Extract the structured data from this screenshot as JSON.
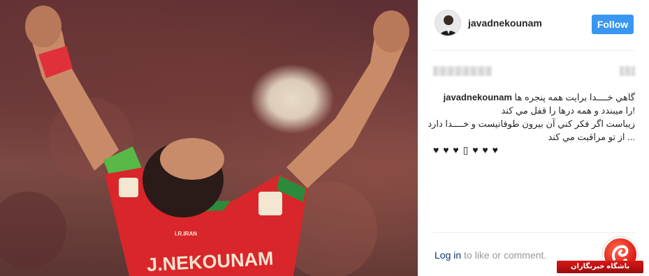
{
  "post": {
    "username": "javadnekounam",
    "follow_label": "Follow",
    "caption_user": "javadnekounam",
    "caption_lines": [
      "گاهي خــــدا برايت همه پنجره ها",
      "!را ميبندد و همه درها را قفل مي كند",
      "زيباست اگر فكر كني آن بيرون طوفانيست و خــــدا دارد",
      "... از تو مراقبت مي كند"
    ],
    "hearts": "♥ ♥ ♥ ▯ ♥ ♥ ♥",
    "jersey_name": "J.NEKOUNAM",
    "jersey_small": "I.R.IRAN"
  },
  "footer": {
    "login_label": "Log in",
    "rest_text": " to like or comment."
  },
  "watermark": {
    "text": "باشگاه خبرنگاران"
  },
  "colors": {
    "follow_blue": "#3897f0",
    "login_link": "#003569",
    "jersey_red": "#d8262a",
    "watermark_red": "#e2231a"
  }
}
